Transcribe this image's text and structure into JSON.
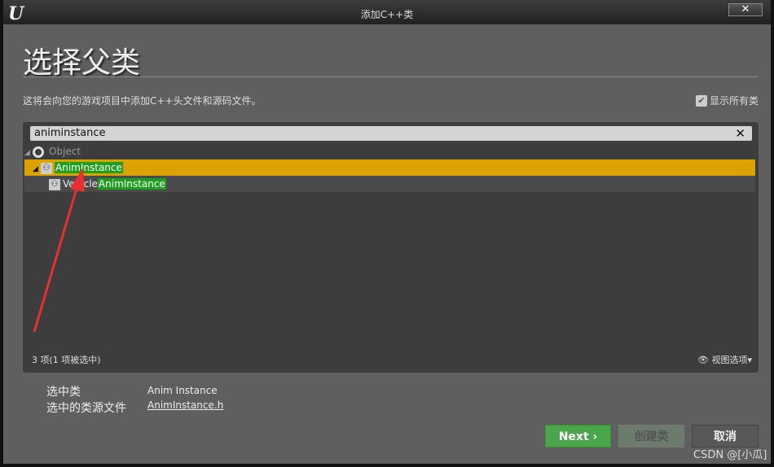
{
  "window": {
    "title": "添加C++类",
    "logo": "U",
    "close": "✕"
  },
  "heading": "选择父类",
  "description": "这将会向您的游戏项目中添加C++头文件和源码文件。",
  "show_all": {
    "label": "显示所有类",
    "checked": true
  },
  "search": {
    "value": "animinstance",
    "clear": "✕"
  },
  "tree": [
    {
      "prefix": "",
      "match": "",
      "label": "Object",
      "icon": "circle-icon"
    },
    {
      "prefix": "",
      "match": "AnimInstance",
      "icon": "anim-icon",
      "selected": true
    },
    {
      "prefix": "Vehicle",
      "match": "AnimInstance",
      "icon": "anim-icon"
    }
  ],
  "status": {
    "count": "3 项(1 项被选中)",
    "view_options": "视图选项"
  },
  "details": {
    "class_label": "选中类",
    "class_value": "Anim Instance",
    "source_label": "选中的类源文件",
    "source_value": "AnimInstance.h"
  },
  "buttons": {
    "next": "Next",
    "create": "创建类",
    "cancel": "取消"
  },
  "watermark": "CSDN @[小瓜]",
  "colors": {
    "selected": "#dba200",
    "match": "#1ea01e",
    "next": "#4aa64a"
  }
}
